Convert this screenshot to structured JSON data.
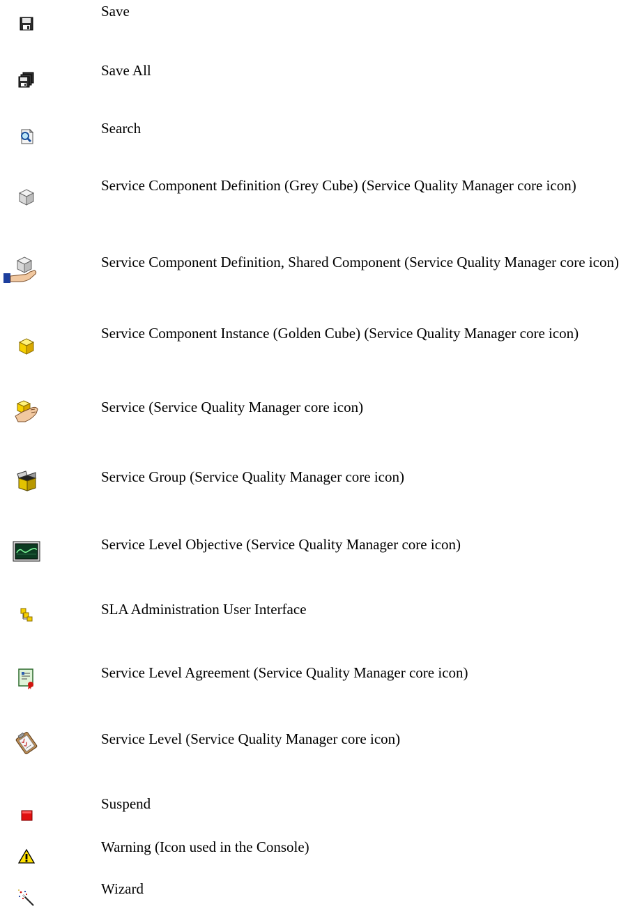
{
  "entries": [
    {
      "icon": "save-icon",
      "text": "Save"
    },
    {
      "icon": "save-all-icon",
      "text": "Save All"
    },
    {
      "icon": "search-icon",
      "text": "Search"
    },
    {
      "icon": "grey-cube-icon",
      "text": "Service Component Definition  (Grey Cube) (Service Quality Manager core icon)"
    },
    {
      "icon": "shared-component-icon",
      "text": "Service Component Definition, Shared Component (Service Quality Manager core icon)"
    },
    {
      "icon": "golden-cube-icon",
      "text": "Service Component Instance  (Golden Cube) (Service Quality Manager core icon)"
    },
    {
      "icon": "service-icon",
      "text": "Service (Service Quality Manager core icon)"
    },
    {
      "icon": "service-group-icon",
      "text": "Service Group (Service Quality Manager core icon)"
    },
    {
      "icon": "service-level-objective-icon",
      "text": "Service Level Objective (Service Quality Manager core icon)"
    },
    {
      "icon": "sla-admin-ui-icon",
      "text": "SLA Administration User Interface"
    },
    {
      "icon": "service-level-agreement-icon",
      "text": "Service Level Agreement (Service Quality Manager core icon)"
    },
    {
      "icon": "service-level-icon",
      "text": "Service Level (Service Quality Manager core icon)"
    },
    {
      "icon": "suspend-icon",
      "text": "Suspend"
    },
    {
      "icon": "warning-icon",
      "text": "Warning (Icon used in the Console)"
    },
    {
      "icon": "wizard-icon",
      "text": "Wizard"
    }
  ]
}
